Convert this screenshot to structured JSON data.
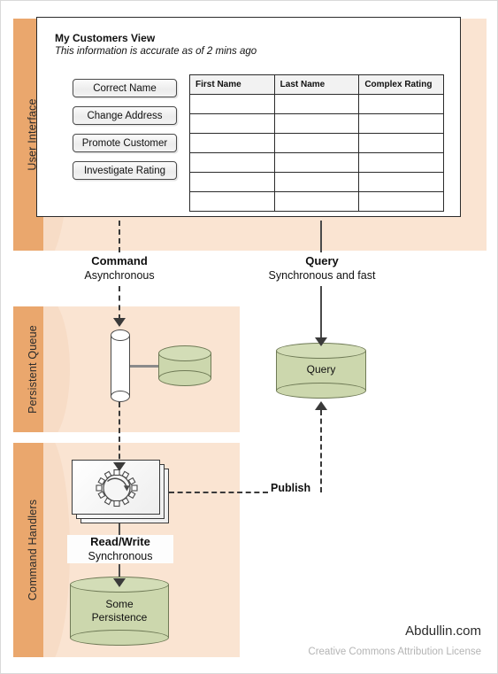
{
  "diagram": {
    "lanes": [
      {
        "label": "User Interface"
      },
      {
        "label": "Persistent Queue"
      },
      {
        "label": "Command Handlers"
      }
    ],
    "ui_view": {
      "title": "My Customers View",
      "subtitle": "This information is accurate as of 2 mins ago",
      "buttons": [
        "Correct Name",
        "Change Address",
        "Promote Customer",
        "Investigate Rating"
      ],
      "table": {
        "columns": [
          "First Name",
          "Last Name",
          "Complex Rating"
        ],
        "rows": [
          [
            "",
            "",
            ""
          ],
          [
            "",
            "",
            ""
          ],
          [
            "",
            "",
            ""
          ],
          [
            "",
            "",
            ""
          ],
          [
            "",
            "",
            ""
          ],
          [
            "",
            "",
            ""
          ]
        ]
      }
    },
    "flows": [
      {
        "title": "Command",
        "subtitle": "Asynchronous"
      },
      {
        "title": "Query",
        "subtitle": "Synchronous and fast"
      },
      {
        "title": "Read/Write",
        "subtitle": "Synchronous"
      }
    ],
    "publish_label": "Publish",
    "nodes": {
      "query_store": "Query",
      "persistence_line1": "Some",
      "persistence_line2": "Persistence"
    },
    "icons": {
      "gear": "gear-icon"
    }
  },
  "footer": {
    "brand": "Abdullin.com",
    "license": "Creative Commons Attribution License"
  },
  "colors": {
    "lane_band": "#eaa76d",
    "lane_fill": "#fae4d2",
    "cylinder": "#ccd7ad",
    "cylinder_stroke": "#6f7a56",
    "stroke": "#3a3a3a"
  }
}
